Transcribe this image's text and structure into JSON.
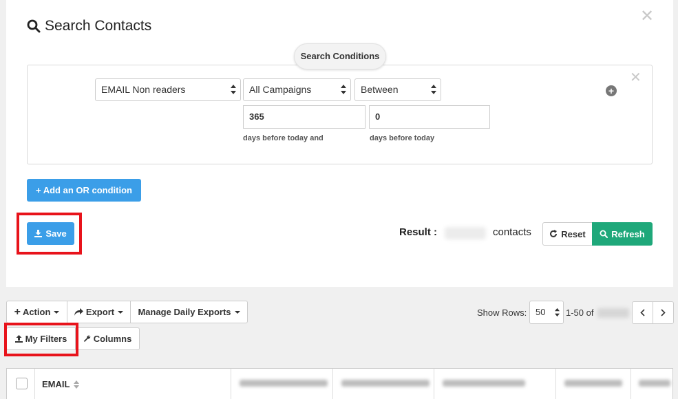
{
  "modal": {
    "title": "Search Contacts",
    "close_icon": "times-icon",
    "conditions_label": "Search Conditions",
    "condition": {
      "field": "EMAIL Non readers",
      "campaign": "All Campaigns",
      "operator": "Between",
      "value_from": "365",
      "value_to": "0",
      "hint_from": "days before today and",
      "hint_to": "days before today"
    },
    "add_or_label": "+ Add an OR condition",
    "save_label": "Save",
    "result_label": "Result :",
    "result_unit": "contacts",
    "reset_label": "Reset",
    "refresh_label": "Refresh"
  },
  "toolbar": {
    "action_label": "Action",
    "export_label": "Export",
    "daily_exports_label": "Manage Daily Exports",
    "my_filters_label": "My Filters",
    "columns_label": "Columns",
    "show_rows_label": "Show Rows:",
    "rows_value": "50",
    "range_text": "1-50 of"
  },
  "table": {
    "email_header": "EMAIL"
  },
  "colors": {
    "primary": "#3b9ee8",
    "success": "#1fa87a",
    "highlight": "#e8131b"
  }
}
